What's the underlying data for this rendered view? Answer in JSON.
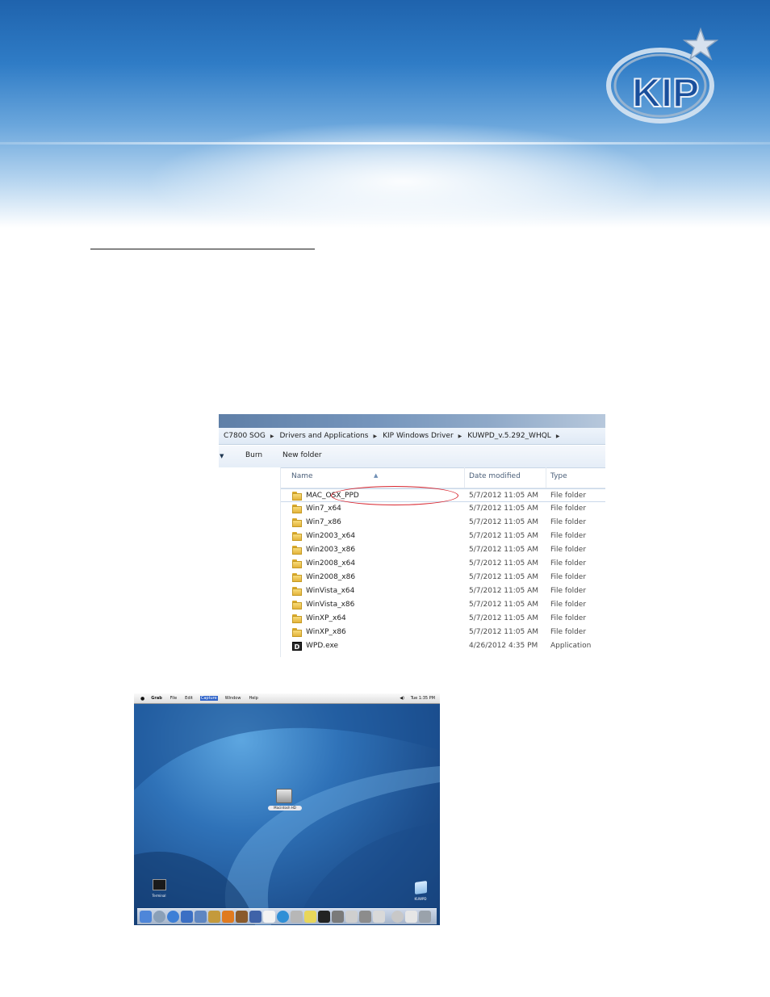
{
  "logo": {
    "text": "KIP"
  },
  "explorer": {
    "breadcrumb": [
      "C7800 SOG",
      "Drivers and Applications",
      "KIP Windows Driver",
      "KUWPD_v.5.292_WHQL"
    ],
    "toolbar": {
      "burn_label": "Burn",
      "new_folder_label": "New folder"
    },
    "columns": {
      "name": "Name",
      "date": "Date modified",
      "type": "Type"
    },
    "rows": [
      {
        "name": "MAC_OSX_PPD",
        "date": "5/7/2012 11:05 AM",
        "type": "File folder",
        "icon": "folder-icon"
      },
      {
        "name": "Win7_x64",
        "date": "5/7/2012 11:05 AM",
        "type": "File folder",
        "icon": "folder-icon"
      },
      {
        "name": "Win7_x86",
        "date": "5/7/2012 11:05 AM",
        "type": "File folder",
        "icon": "folder-icon"
      },
      {
        "name": "Win2003_x64",
        "date": "5/7/2012 11:05 AM",
        "type": "File folder",
        "icon": "folder-icon"
      },
      {
        "name": "Win2003_x86",
        "date": "5/7/2012 11:05 AM",
        "type": "File folder",
        "icon": "folder-icon"
      },
      {
        "name": "Win2008_x64",
        "date": "5/7/2012 11:05 AM",
        "type": "File folder",
        "icon": "folder-icon"
      },
      {
        "name": "Win2008_x86",
        "date": "5/7/2012 11:05 AM",
        "type": "File folder",
        "icon": "folder-icon"
      },
      {
        "name": "WinVista_x64",
        "date": "5/7/2012 11:05 AM",
        "type": "File folder",
        "icon": "folder-icon"
      },
      {
        "name": "WinVista_x86",
        "date": "5/7/2012 11:05 AM",
        "type": "File folder",
        "icon": "folder-icon"
      },
      {
        "name": "WinXP_x64",
        "date": "5/7/2012 11:05 AM",
        "type": "File folder",
        "icon": "folder-icon"
      },
      {
        "name": "WinXP_x86",
        "date": "5/7/2012 11:05 AM",
        "type": "File folder",
        "icon": "folder-icon"
      },
      {
        "name": "WPD.exe",
        "date": "4/26/2012 4:35 PM",
        "type": "Application",
        "icon": "application-icon"
      }
    ],
    "highlight_color": "#d8262f"
  },
  "mac": {
    "menubar": {
      "app_name": "Grab",
      "menus": [
        "File",
        "Edit",
        "Capture",
        "Window",
        "Help"
      ],
      "active_menu": "Capture",
      "clock": "Tue 1:35 PM"
    },
    "desktop_icons": {
      "hard_drive": "Macintosh HD",
      "terminal": "Terminal",
      "kuwpd": "KUWPD"
    }
  }
}
